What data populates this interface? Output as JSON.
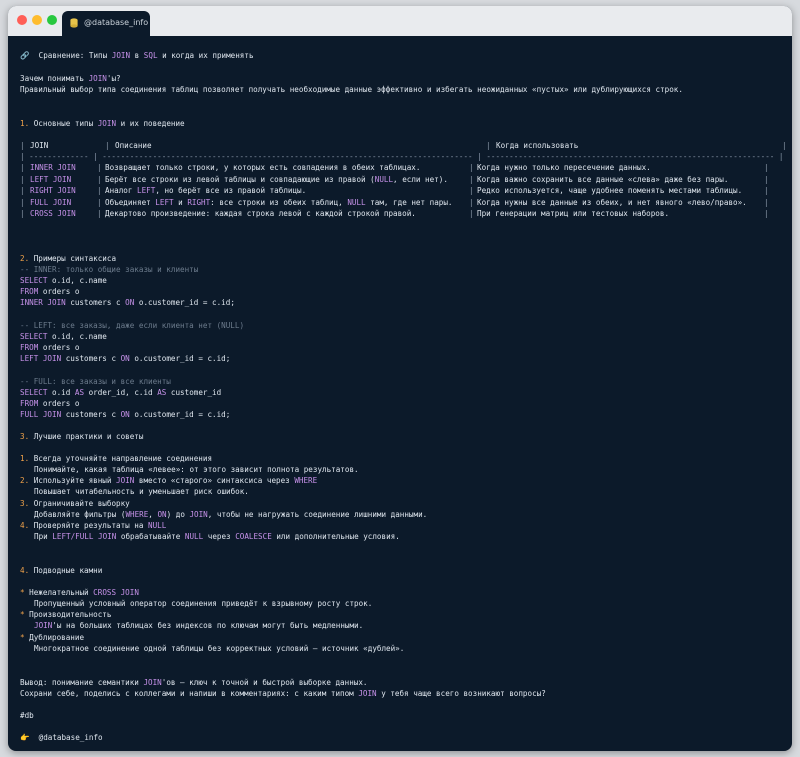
{
  "window": {
    "tab_label": "@database_info",
    "traffic_lights": {
      "close": "#ff5f57",
      "minimize": "#febc2e",
      "maximize": "#28c840"
    }
  },
  "colors": {
    "background": "#0c1a2a",
    "keyword": "#c792ea",
    "number": "#f0a24a",
    "comment": "#6c7b8c",
    "text": "#dfe6ee"
  },
  "post": {
    "title_icon": "link-icon",
    "title": [
      "Сравнение: Типы ",
      "JOIN",
      " в ",
      "SQL",
      " и когда их применять"
    ],
    "why_heading": [
      "Зачем понимать ",
      "JOIN",
      "'ы?"
    ],
    "why_text": "Правильный выбор типа соединения таблиц позволяет получать необходимые данные эффективно и избегать неожиданных «пустых» или дублирующихся строк.",
    "s1": {
      "num": "1.",
      "title": [
        " Основные типы ",
        "JOIN",
        " и их поведение"
      ]
    },
    "table": {
      "headers": [
        "JOIN",
        "Описание",
        "Когда использовать"
      ],
      "rows": [
        {
          "join": "INNER JOIN",
          "desc": [
            [
              "Возвращает только строки, у которых есть совпадения в обеих таблицах.",
              ""
            ]
          ],
          "when": "Когда нужно только пересечение данных."
        },
        {
          "join": "LEFT JOIN",
          "desc": [
            [
              "Берёт все строки из левой таблицы и совпадающие из правой (",
              ""
            ],
            [
              "NULL",
              "k"
            ],
            [
              ", если нет).",
              ""
            ]
          ],
          "when": "Когда важно сохранить все данные «слева» даже без пары."
        },
        {
          "join": "RIGHT JOIN",
          "desc": [
            [
              "Аналог ",
              ""
            ],
            [
              "LEFT",
              "k"
            ],
            [
              ", но берёт все из правой таблицы.",
              ""
            ]
          ],
          "when": "Редко используется, чаще удобнее поменять местами таблицы."
        },
        {
          "join": "FULL JOIN",
          "desc": [
            [
              "Объединяет ",
              ""
            ],
            [
              "LEFT",
              "k"
            ],
            [
              " и ",
              ""
            ],
            [
              "RIGHT",
              "k"
            ],
            [
              ": все строки из обеих таблиц, ",
              ""
            ],
            [
              "NULL",
              "k"
            ],
            [
              " там, где нет пары.",
              ""
            ]
          ],
          "when": "Когда нужны все данные из обеих, и нет явного «лево/право»."
        },
        {
          "join": "CROSS JOIN",
          "desc": [
            [
              "Декартово произведение: каждая строка левой с каждой строкой правой.",
              ""
            ]
          ],
          "when": "При генерации матриц или тестовых наборов."
        }
      ]
    },
    "s2": {
      "num": "2.",
      "title": " Примеры синтаксиса"
    },
    "ex_inner": {
      "comment": "-- INNER: только общие заказы и клиенты",
      "select": [
        [
          "SELECT",
          "k"
        ],
        [
          " o.id, c.name",
          ""
        ]
      ],
      "from": [
        [
          "FROM",
          "k"
        ],
        [
          " orders o",
          ""
        ]
      ],
      "join": [
        [
          "INNER JOIN",
          "k"
        ],
        [
          " customers c ",
          ""
        ],
        [
          "ON",
          "k"
        ],
        [
          " o.customer_id = c.id;",
          ""
        ]
      ]
    },
    "ex_left": {
      "comment": "-- LEFT: все заказы, даже если клиента нет (NULL)",
      "select": [
        [
          "SELECT",
          "k"
        ],
        [
          " o.id, c.name",
          ""
        ]
      ],
      "from": [
        [
          "FROM",
          "k"
        ],
        [
          " orders o",
          ""
        ]
      ],
      "join": [
        [
          "LEFT JOIN",
          "k"
        ],
        [
          " customers c ",
          ""
        ],
        [
          "ON",
          "k"
        ],
        [
          " o.customer_id = c.id;",
          ""
        ]
      ]
    },
    "ex_full": {
      "comment": "-- FULL: все заказы и все клиенты",
      "select": [
        [
          "SELECT",
          "k"
        ],
        [
          " o.id ",
          ""
        ],
        [
          "AS",
          "k"
        ],
        [
          " order_id, c.id ",
          ""
        ],
        [
          "AS",
          "k"
        ],
        [
          " customer_id",
          ""
        ]
      ],
      "from": [
        [
          "FROM",
          "k"
        ],
        [
          " orders o",
          ""
        ]
      ],
      "join": [
        [
          "FULL JOIN",
          "k"
        ],
        [
          " customers c ",
          ""
        ],
        [
          "ON",
          "k"
        ],
        [
          " o.customer_id = c.id;",
          ""
        ]
      ]
    },
    "s3": {
      "num": "3.",
      "title": " Лучшие практики и советы"
    },
    "practices": [
      {
        "num": "1.",
        "title": [
          [
            "Всегда уточняйте направление соединения",
            ""
          ]
        ],
        "text": [
          [
            "Понимайте, какая таблица «левее»: от этого зависит полнота результатов.",
            ""
          ]
        ]
      },
      {
        "num": "2.",
        "title": [
          [
            "Используйте явный ",
            ""
          ],
          [
            "JOIN",
            "k"
          ],
          [
            " вместо «старого» синтаксиса через ",
            ""
          ],
          [
            "WHERE",
            "k"
          ]
        ],
        "text": [
          [
            "Повышает читабельность и уменьшает риск ошибок.",
            ""
          ]
        ]
      },
      {
        "num": "3.",
        "title": [
          [
            "Ограничивайте выборку",
            ""
          ]
        ],
        "text": [
          [
            "Добавляйте фильтры (",
            ""
          ],
          [
            "WHERE",
            "k"
          ],
          [
            ", ",
            ""
          ],
          [
            "ON",
            "k"
          ],
          [
            ") до ",
            ""
          ],
          [
            "JOIN",
            "k"
          ],
          [
            ", чтобы не нагружать соединение лишними данными.",
            ""
          ]
        ]
      },
      {
        "num": "4.",
        "title": [
          [
            "Проверяйте результаты на ",
            ""
          ],
          [
            "NULL",
            "k"
          ]
        ],
        "text": [
          [
            "При ",
            ""
          ],
          [
            "LEFT/FULL JOIN",
            "k"
          ],
          [
            " обрабатывайте ",
            ""
          ],
          [
            "NULL",
            "k"
          ],
          [
            " через ",
            ""
          ],
          [
            "COALESCE",
            "k"
          ],
          [
            " или дополнительные условия.",
            ""
          ]
        ]
      }
    ],
    "s4": {
      "num": "4.",
      "title": " Подводные камни"
    },
    "pitfalls": [
      {
        "title": [
          [
            "Нежелательный ",
            ""
          ],
          [
            "CROSS JOIN",
            "k"
          ]
        ],
        "text": [
          [
            "Пропущенный условный оператор соединения приведёт к взрывному росту строк.",
            ""
          ]
        ]
      },
      {
        "title": [
          [
            "Производительность",
            ""
          ]
        ],
        "text": [
          [
            "JOIN",
            "k"
          ],
          [
            "'ы на больших таблицах без индексов по ключам могут быть медленными.",
            ""
          ]
        ]
      },
      {
        "title": [
          [
            "Дублирование",
            ""
          ]
        ],
        "text": [
          [
            "Многократное соединение одной таблицы без корректных условий — источник «дублей».",
            ""
          ]
        ]
      }
    ],
    "bullet": "*",
    "conclusion": [
      [
        "Вывод: понимание семантики ",
        ""
      ],
      [
        "JOIN",
        "k"
      ],
      [
        "'ов — ключ к точной и быстрой выборке данных.",
        ""
      ]
    ],
    "cta": [
      [
        "Сохрани себе, поделись с коллегами и напиши в комментариях: с каким типом ",
        ""
      ],
      [
        "JOIN",
        "k"
      ],
      [
        " у тебя чаще всего возникают вопросы?",
        ""
      ]
    ],
    "hashtag": "#db",
    "footer_icon": "pointing-hand-icon",
    "footer": "@database_info"
  }
}
